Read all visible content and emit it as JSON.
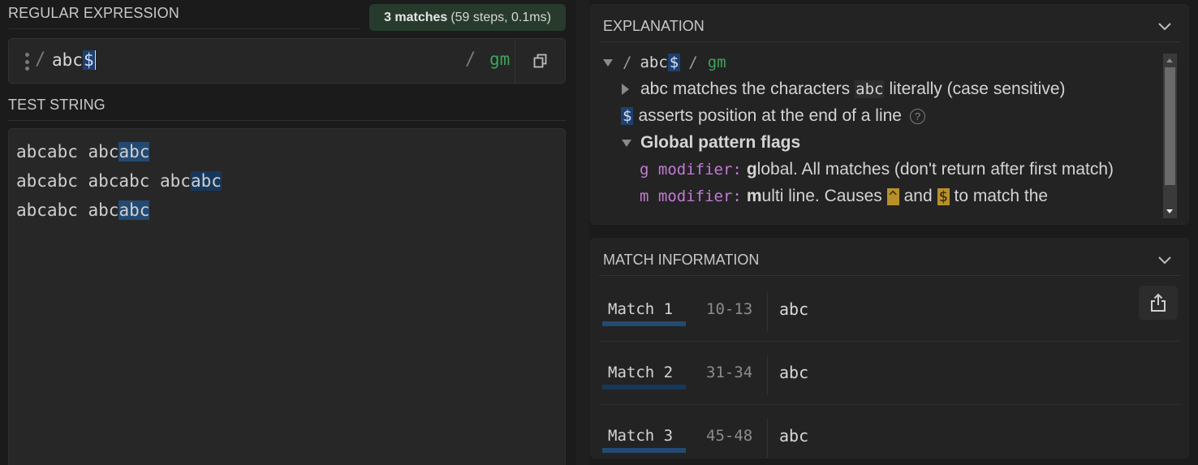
{
  "regex_section": {
    "title": "REGULAR EXPRESSION",
    "status": {
      "count": "3 matches",
      "detail": "(59 steps, 0.1ms)"
    },
    "open_delimiter": "/",
    "pattern_literal": "abc",
    "pattern_anchor": "$",
    "close_delimiter": "/",
    "flags": "gm",
    "copy_icon": "copy-icon",
    "handle_icon": "drag-handle-icon"
  },
  "test_section": {
    "title": "TEST STRING",
    "lines": [
      {
        "before": "abcabc abc",
        "match": "abc"
      },
      {
        "before": "abcabc abcabc abc",
        "match": "abc"
      },
      {
        "before": "abcabc abc",
        "match": "abc"
      }
    ]
  },
  "explanation": {
    "title": "EXPLANATION",
    "collapse_icon": "chevron-down-icon",
    "root": {
      "open": "/",
      "literal": "abc",
      "anchor": "$",
      "close": "/",
      "flags": "gm"
    },
    "token_abc": {
      "token": "abc",
      "text_before": "matches the characters",
      "chip": "abc",
      "text_after": "literally (case sensitive)"
    },
    "token_dollar": {
      "token": "$",
      "text": "asserts position at the end of a line",
      "help_icon": "?"
    },
    "flags_heading": "Global pattern flags",
    "flag_g": {
      "modifier": "g modifier:",
      "bold": "g",
      "text": "lobal. All matches (don't return after first match)"
    },
    "flag_m": {
      "modifier": "m modifier:",
      "bold": "m",
      "text_before": "ulti line. Causes",
      "caret": "^",
      "and": "and",
      "dollar": "$",
      "text_after": "to match the"
    }
  },
  "match_info": {
    "title": "MATCH INFORMATION",
    "collapse_icon": "chevron-down-icon",
    "share_icon": "share-export-icon",
    "matches": [
      {
        "label": "Match 1",
        "range": "10-13",
        "value": "abc"
      },
      {
        "label": "Match 2",
        "range": "31-34",
        "value": "abc"
      },
      {
        "label": "Match 3",
        "range": "45-48",
        "value": "abc"
      }
    ]
  },
  "colors": {
    "match_highlight": "#234a72",
    "flags_green": "#3ea55a",
    "modifier_purple": "#c27ad4",
    "anchor_gold": "#b7902a",
    "status_bg": "#273b2d"
  }
}
